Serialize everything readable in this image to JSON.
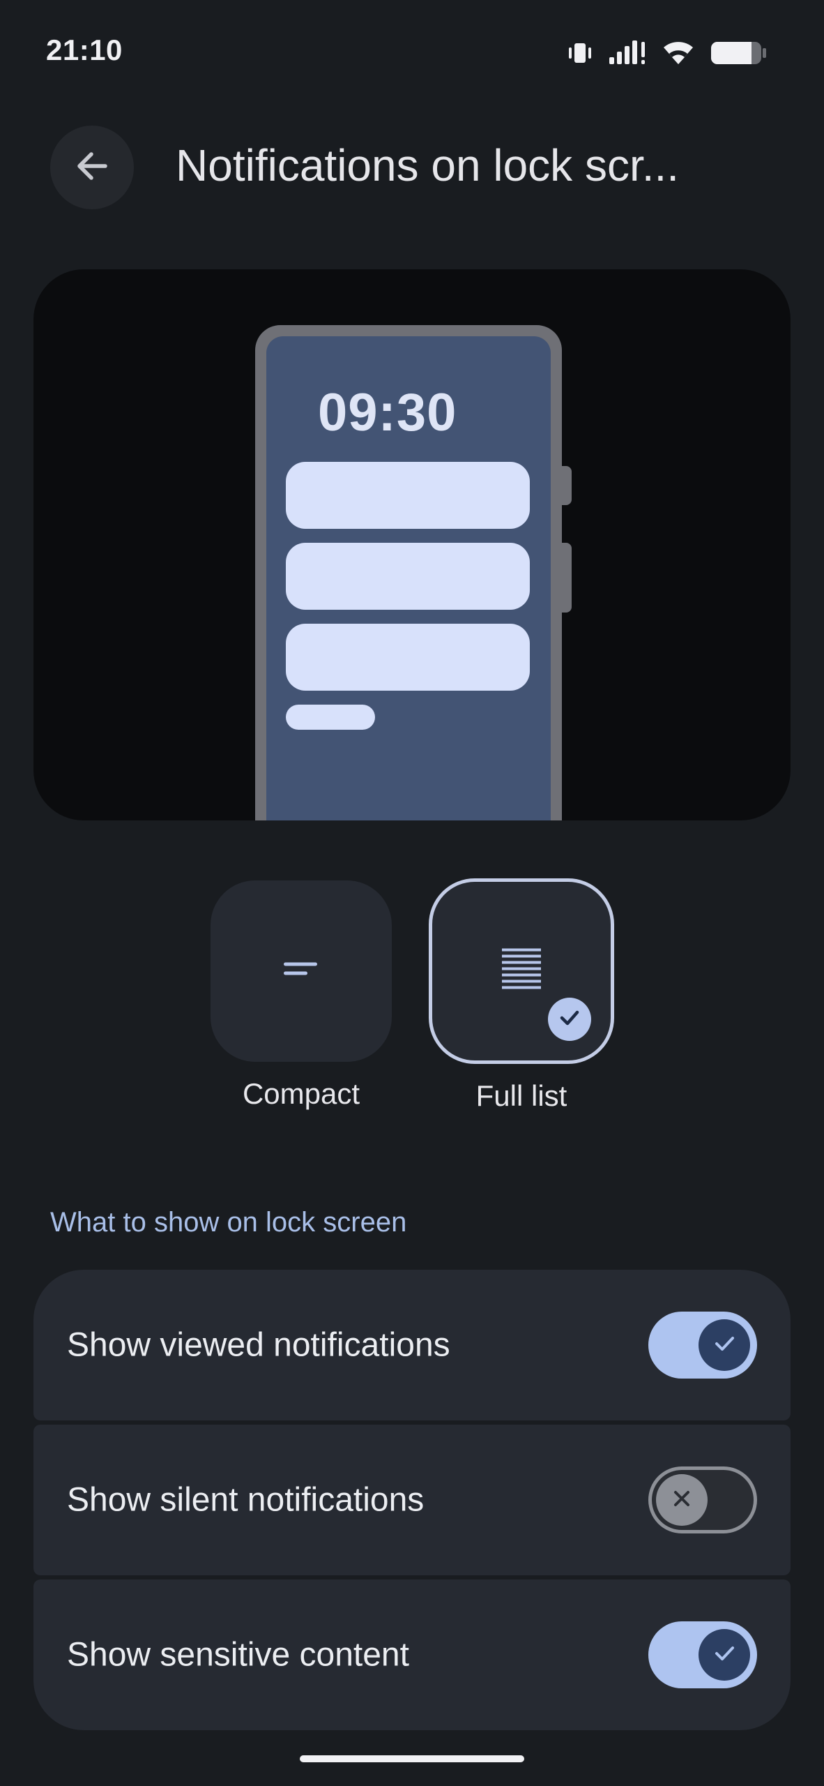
{
  "status_bar": {
    "time": "21:10",
    "icons": [
      "vibrate-icon",
      "signal-icon",
      "wifi-icon",
      "battery-icon"
    ],
    "battery_level": 0.75
  },
  "header": {
    "back_icon": "arrow-back-icon",
    "title": "Notifications on lock scr..."
  },
  "preview": {
    "clock": "09:30"
  },
  "style_options": [
    {
      "label": "Compact",
      "icon": "compact-lines-icon",
      "selected": false
    },
    {
      "label": "Full list",
      "icon": "full-list-lines-icon",
      "selected": true
    }
  ],
  "section": {
    "title": "What to show on lock screen"
  },
  "settings": [
    {
      "label": "Show viewed notifications",
      "enabled": true
    },
    {
      "label": "Show silent notifications",
      "enabled": false
    },
    {
      "label": "Show sensitive content",
      "enabled": true
    }
  ],
  "colors": {
    "background": "#191c20",
    "accent": "#aec4f0",
    "card": "#262a32",
    "section_header": "#a9bfe8"
  }
}
